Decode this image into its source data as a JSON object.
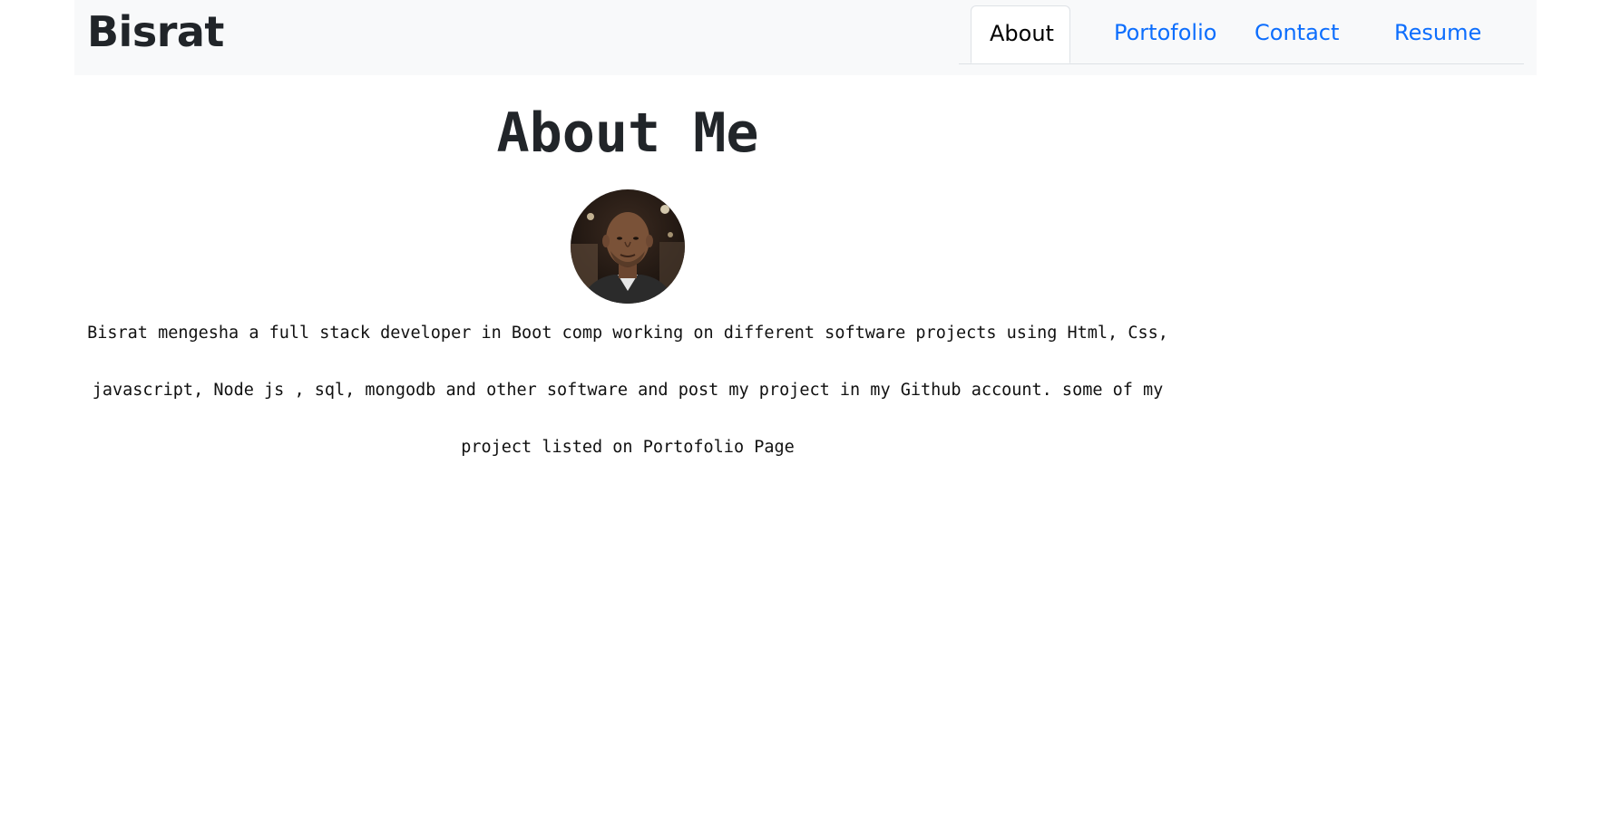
{
  "navbar": {
    "brand": "Bisrat",
    "tabs": [
      {
        "label": "About",
        "active": true
      },
      {
        "label": "Portofolio",
        "active": false
      },
      {
        "label": "Contact",
        "active": false
      },
      {
        "label": "Resume",
        "active": false
      }
    ]
  },
  "main": {
    "title": "About Me",
    "bio": "Bisrat mengesha a full stack developer in Boot comp working on different software projects using Html, Css, javascript, Node js , sql, mongodb and other software and post my project in my Github account. some of my project listed on Portofolio Page",
    "avatar_icon": "profile-photo"
  },
  "colors": {
    "link": "#0d6efd",
    "navbar_bg": "#f8f9fa",
    "text": "#212529"
  }
}
